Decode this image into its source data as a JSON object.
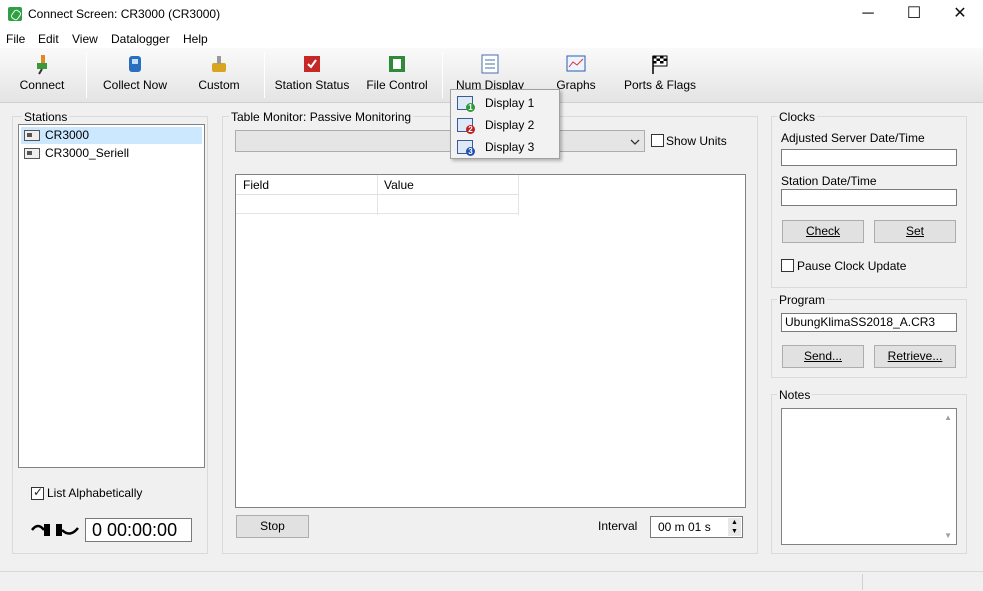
{
  "window": {
    "title": "Connect Screen: CR3000 (CR3000)",
    "minimize": "─",
    "maximize": "☐",
    "close": "✕"
  },
  "menu": [
    "File",
    "Edit",
    "View",
    "Datalogger",
    "Help"
  ],
  "toolbar": {
    "connect": "Connect",
    "collect_now": "Collect Now",
    "custom": "Custom",
    "station_status": "Station Status",
    "file_control": "File Control",
    "num_display": "Num Display",
    "graphs": "Graphs",
    "ports_flags": "Ports & Flags"
  },
  "stations": {
    "label": "Stations",
    "items": [
      "CR3000",
      "CR3000_Seriell"
    ],
    "selected": "CR3000",
    "list_alphabetically": "List Alphabetically",
    "timer": "0 00:00:00"
  },
  "table_monitor": {
    "label": "Table Monitor: Passive Monitoring",
    "show_units": "Show Units",
    "columns": [
      "Field",
      "Value"
    ],
    "stop": "Stop",
    "interval_label": "Interval",
    "interval_value": "00 m 01 s"
  },
  "num_display_menu": [
    "Display 1",
    "Display 2",
    "Display 3"
  ],
  "clocks": {
    "label": "Clocks",
    "adjusted_server": "Adjusted Server Date/Time",
    "station_date": "Station Date/Time",
    "check": "Check",
    "set": "Set",
    "pause": "Pause Clock Update"
  },
  "program": {
    "label": "Program",
    "value": "UbungKlimaSS2018_A.CR3",
    "send": "Send...",
    "retrieve": "Retrieve..."
  },
  "notes": {
    "label": "Notes"
  },
  "colors": {
    "selection": "#cce8ff",
    "accent_green": "#2ea043",
    "popup_num_1": "#2e9a3a",
    "popup_num_2": "#c02020",
    "popup_num_3": "#2050b0"
  }
}
